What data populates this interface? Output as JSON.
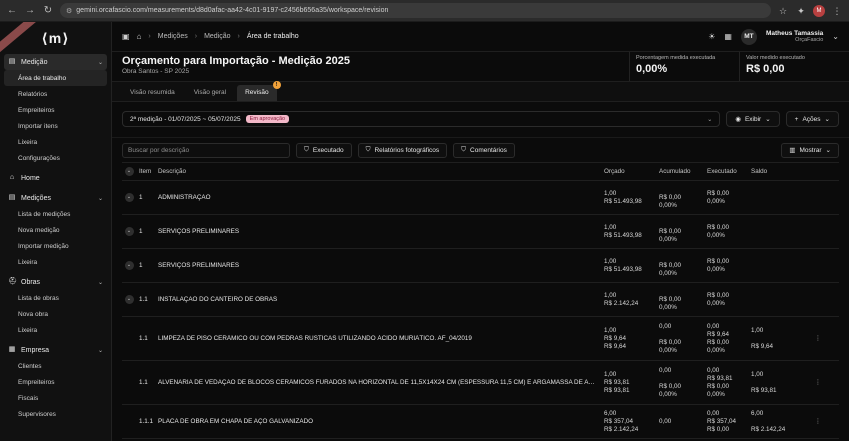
{
  "browser": {
    "url": "gemini.orcafascio.com/measurements/d8d0afac-aa42-4c01-9197-c2456b656a35/workspace/revision",
    "avatar": "M"
  },
  "sidebar": {
    "logo": "⟨m⟩",
    "ribbon": "",
    "groups": [
      {
        "label": "Medição",
        "icon": "doc-icon",
        "items": [
          "Área de trabalho",
          "Relatórios",
          "Empreiteiros",
          "Importar itens",
          "Lixeira",
          "Configurações"
        ]
      },
      {
        "label": "Home",
        "icon": "home-icon",
        "items": []
      },
      {
        "label": "Medições",
        "icon": "doc-icon",
        "items": [
          "Lista de medições",
          "Nova medição",
          "Importar medição",
          "Lixeira"
        ]
      },
      {
        "label": "Obras",
        "icon": "hardhat-icon",
        "items": [
          "Lista de obras",
          "Nova obra",
          "Lixeira"
        ]
      },
      {
        "label": "Empresa",
        "icon": "building-icon",
        "items": [
          "Clientes",
          "Empreiteiros",
          "Fiscais",
          "Supervisores"
        ]
      }
    ]
  },
  "topbar": {
    "breadcrumb": [
      "Medições",
      "Medição",
      "Área de trabalho"
    ],
    "user_initials": "MT",
    "user_name": "Matheus Tamassia",
    "user_org": "OrçaFascio"
  },
  "header": {
    "title": "Orçamento para Importação - Medição 2025",
    "subtitle": "Obra Santos - SP 2025",
    "kpis": [
      {
        "label": "Porcentagem medida executada",
        "value": "0,00%"
      },
      {
        "label": "Valor medido executado",
        "value": "R$ 0,00"
      }
    ]
  },
  "tabs": [
    {
      "label": "Visão resumida",
      "active": false
    },
    {
      "label": "Visão geral",
      "active": false
    },
    {
      "label": "Revisão",
      "active": true,
      "badge": "!"
    }
  ],
  "period": {
    "label": "2ª medição - 01/07/2025 ~ 05/07/2025",
    "status": "Em aprovação",
    "view_button": "Exibir",
    "actions_button": "Ações"
  },
  "filters": {
    "search_placeholder": "Buscar por descrição",
    "executed": "Executado",
    "photo_reports": "Relatórios fotográficos",
    "comments": "Comentários",
    "show": "Mostrar"
  },
  "table": {
    "headers": {
      "item": "Item",
      "description": "Descrição",
      "budget": "Orçado",
      "accumulated": "Acumulado",
      "executed": "Executado",
      "balance": "Saldo"
    },
    "rows": [
      {
        "expand": true,
        "item": "1",
        "desc": "ADMINISTRAÇÃO",
        "orc": [
          "1,00",
          "R$ 51.493,98"
        ],
        "acu": [
          "",
          "R$ 0,00",
          "0,00%"
        ],
        "exe": [
          "R$ 0,00",
          "0,00%"
        ],
        "sal": [],
        "menu": false
      },
      {
        "expand": true,
        "item": "1",
        "desc": "SERVIÇOS PRELIMINARES",
        "orc": [
          "1,00",
          "R$ 51.493,98"
        ],
        "acu": [
          "",
          "R$ 0,00",
          "0,00%"
        ],
        "exe": [
          "R$ 0,00",
          "0,00%"
        ],
        "sal": [],
        "menu": false
      },
      {
        "expand": true,
        "item": "1",
        "desc": "SERVIÇOS PRELIMINARES",
        "orc": [
          "1,00",
          "R$ 51.493,98"
        ],
        "acu": [
          "",
          "R$ 0,00",
          "0,00%"
        ],
        "exe": [
          "R$ 0,00",
          "0,00%"
        ],
        "sal": [],
        "menu": false
      },
      {
        "expand": true,
        "item": "1.1",
        "desc": "INSTALAÇÃO DO CANTEIRO DE OBRAS",
        "orc": [
          "1,00",
          "R$ 2.142,24"
        ],
        "acu": [
          "",
          "R$ 0,00",
          "0,00%"
        ],
        "exe": [
          "R$ 0,00",
          "0,00%"
        ],
        "sal": [],
        "menu": false
      },
      {
        "expand": false,
        "item": "1.1",
        "desc": "LIMPEZA DE PISO CERÂMICO OU COM PEDRAS RÚSTICAS UTILIZANDO ÁCIDO MURIÁTICO. AF_04/2019",
        "orc": [
          "1,00",
          "R$ 9,64",
          "R$ 9,64"
        ],
        "acu": [
          "0,00",
          "",
          "R$ 0,00",
          "0,00%"
        ],
        "exe": [
          "0,00",
          "R$ 9,64",
          "R$ 0,00",
          "0,00%"
        ],
        "sal": [
          "1,00",
          "",
          "R$ 9,64"
        ],
        "menu": true
      },
      {
        "expand": false,
        "item": "1.1",
        "desc": "ALVENARIA DE VEDAÇÃO DE BLOCOS CERÂMICOS FURADOS NA HORIZONTAL DE 11,5X14X24 CM (ESPESSURA 11,5 CM) E ARGAMASSA DE ASSENTAMENTO",
        "orc": [
          "1,00",
          "R$ 93,81",
          "R$ 93,81"
        ],
        "acu": [
          "0,00",
          "",
          "R$ 0,00",
          "0,00%"
        ],
        "exe": [
          "0,00",
          "R$ 93,81",
          "R$ 0,00",
          "0,00%"
        ],
        "sal": [
          "1,00",
          "",
          "R$ 93,81"
        ],
        "menu": true
      },
      {
        "expand": false,
        "item": "1.1.1",
        "desc": "PLACA DE OBRA EM CHAPA DE AÇO GALVANIZADO",
        "orc": [
          "6,00",
          "R$ 357,04",
          "R$ 2.142,24"
        ],
        "acu": [
          "0,00"
        ],
        "exe": [
          "0,00",
          "R$ 357,04",
          "R$ 0,00"
        ],
        "sal": [
          "6,00",
          "",
          "R$ 2.142,24"
        ],
        "menu": true
      }
    ]
  }
}
